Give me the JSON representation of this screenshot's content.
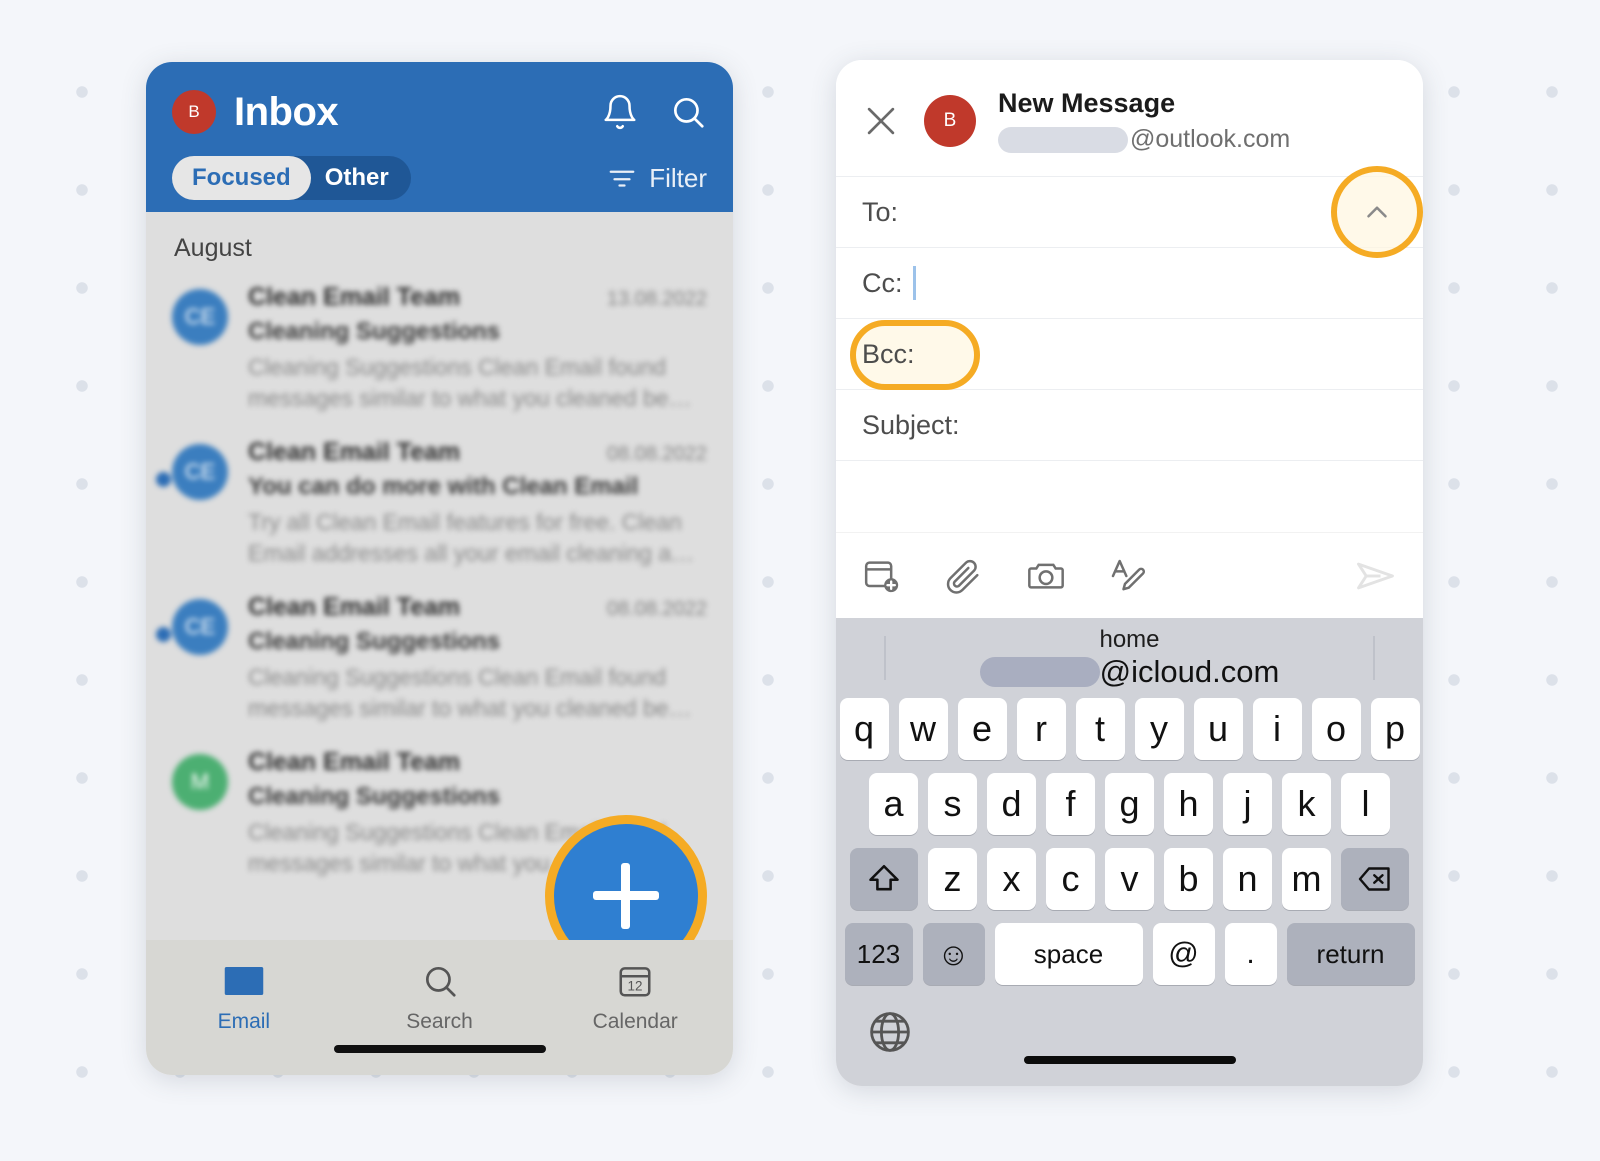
{
  "inbox": {
    "account_initial": "B",
    "title": "Inbox",
    "notifications_icon": "bell-icon",
    "search_icon": "search-icon",
    "segments": [
      {
        "label": "Focused",
        "active": true
      },
      {
        "label": "Other",
        "active": false
      }
    ],
    "filter_label": "Filter",
    "filter_icon": "filter-icon",
    "section_label": "August",
    "messages": [
      {
        "avatar_initials": "CE",
        "avatar_color": "#3b7ebf",
        "sender": "Clean Email Team",
        "date": "13.08.2022",
        "subject": "Cleaning Suggestions",
        "preview": "Cleaning Suggestions Clean Email found messages similar to what you cleaned be…",
        "unread": false
      },
      {
        "avatar_initials": "CE",
        "avatar_color": "#3b7ebf",
        "sender": "Clean Email Team",
        "date": "08.08.2022",
        "subject": "You can do more with Clean Email",
        "preview": "Try all Clean Email features for free. Clean Email addresses all your email cleaning a…",
        "unread": true
      },
      {
        "avatar_initials": "CE",
        "avatar_color": "#3b7ebf",
        "sender": "Clean Email Team",
        "date": "08.08.2022",
        "subject": "Cleaning Suggestions",
        "preview": "Cleaning Suggestions Clean Email found messages similar to what you cleaned be…",
        "unread": true
      },
      {
        "avatar_initials": "M",
        "avatar_color": "#4caf72",
        "sender": "Clean Email Team",
        "date": "",
        "subject": "Cleaning Suggestions",
        "preview": "Cleaning Suggestions Clean Email found messages similar to what you clean…",
        "unread": false
      }
    ],
    "compose_fab": {
      "icon": "plus-icon",
      "fill_color": "#2f7fd1",
      "highlight_color": "#f5ab24"
    },
    "tabs": [
      {
        "label": "Email",
        "icon": "envelope-icon",
        "active": true
      },
      {
        "label": "Search",
        "icon": "search-icon",
        "active": false
      },
      {
        "label": "Calendar",
        "icon": "calendar-icon",
        "active": false
      }
    ],
    "calendar_icon_day": "12"
  },
  "compose": {
    "close_icon": "close-icon",
    "account_initial": "B",
    "title": "New Message",
    "account_domain": "@outlook.com",
    "fields": [
      {
        "label": "To:",
        "value": "",
        "has_expand_toggle": true,
        "highlighted_control": true
      },
      {
        "label": "Cc:",
        "value": "",
        "focused": true
      },
      {
        "label": "Bcc:",
        "value": "",
        "highlighted_label": true
      },
      {
        "label": "Subject:",
        "value": ""
      }
    ],
    "expand_icon": "chevron-up-icon",
    "toolbar": [
      {
        "icon": "calendar-add-icon",
        "name": "insert-availability"
      },
      {
        "icon": "paperclip-icon",
        "name": "attach-file"
      },
      {
        "icon": "camera-icon",
        "name": "take-photo"
      },
      {
        "icon": "text-format-icon",
        "name": "format-text"
      }
    ],
    "send_icon": "send-icon",
    "highlight_color": "#f5ab24"
  },
  "keyboard": {
    "suggestion": {
      "top_label": "home",
      "bottom_domain": "@icloud.com"
    },
    "row1": [
      "q",
      "w",
      "e",
      "r",
      "t",
      "y",
      "u",
      "i",
      "o",
      "p"
    ],
    "row2": [
      "a",
      "s",
      "d",
      "f",
      "g",
      "h",
      "j",
      "k",
      "l"
    ],
    "row3_letters": [
      "z",
      "x",
      "c",
      "v",
      "b",
      "n",
      "m"
    ],
    "shift_icon": "shift-icon",
    "backspace_icon": "backspace-icon",
    "row4": {
      "numbers_label": "123",
      "emoji_icon": "emoji-icon",
      "emoji_glyph": "☺",
      "space_label": "space",
      "at_label": "@",
      "dot_label": ".",
      "return_label": "return"
    },
    "globe_icon": "globe-icon"
  }
}
